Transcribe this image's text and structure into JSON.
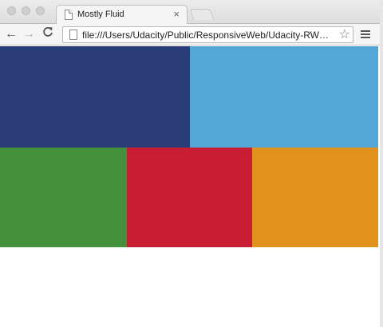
{
  "tab": {
    "title": "Mostly Fluid",
    "close": "×"
  },
  "toolbar": {
    "back": "←",
    "forward": "→",
    "reload": "C",
    "url": "file:///Users/Udacity/Public/ResponsiveWeb/Udacity-RW…",
    "star": "☆"
  },
  "boxes": [
    {
      "color": "#2b3d78"
    },
    {
      "color": "#52a7d6"
    },
    {
      "color": "#43913b"
    },
    {
      "color": "#c91d33"
    },
    {
      "color": "#e0921c"
    }
  ]
}
